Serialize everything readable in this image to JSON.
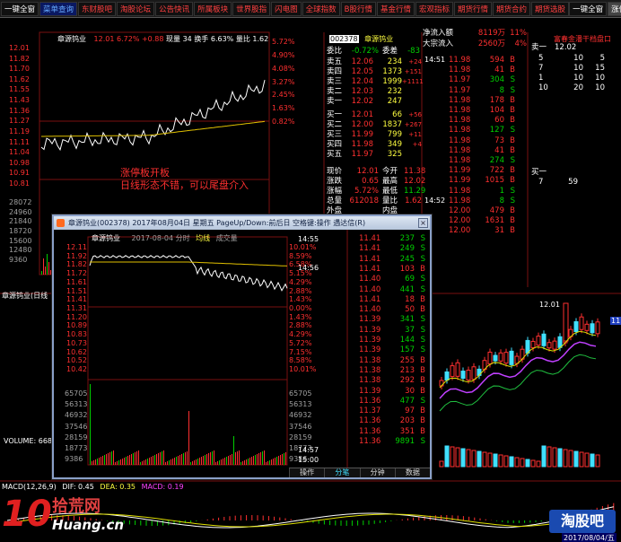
{
  "toolbar": {
    "items": [
      "一键全窗",
      "菜单查询",
      "东财股吧",
      "淘股论坛",
      "公告快讯",
      "所属板块",
      "世界股指",
      "闪电图",
      "全球指数",
      "B股行情",
      "基金行情",
      "宏观指标",
      "期货行情",
      "期货合约",
      "期货选股"
    ],
    "right_items": [
      "一键全窗",
      "涨停闪买"
    ]
  },
  "main_chart": {
    "title": "章源钨业",
    "price": "12.01",
    "pct": "6.72%",
    "change": "+0.88",
    "vol_label": "现量 34",
    "turnover": "换手 6.63%",
    "ratio": "量比 1.62",
    "price_labels": [
      "12.01",
      "11.82",
      "11.70",
      "11.62",
      "11.55",
      "11.43",
      "11.36",
      "11.27",
      "11.19",
      "11.11",
      "11.04",
      "10.98",
      "10.91",
      "10.81"
    ],
    "pct_labels": [
      "5.72%",
      "4.90%",
      "4.08%",
      "3.27%",
      "2.45%",
      "1.63%",
      "0.82%"
    ],
    "vol_labels": [
      "28072",
      "24960",
      "21840",
      "18720",
      "15600",
      "12480",
      "9360"
    ],
    "annotation_line1": "涨停板开板",
    "annotation_line2": "日线形态不错，可以尾盘介入",
    "daily_label": "章源钨业(日线"
  },
  "quote": {
    "code": "002378",
    "name": "章源钨业",
    "weibi_label": "委比",
    "weibi_value": "-0.72%",
    "weicha_label": "委差",
    "weicha_value": "-83",
    "sells": [
      {
        "label": "卖五",
        "price": "12.06",
        "vol": "234",
        "chg": "+24"
      },
      {
        "label": "卖四",
        "price": "12.05",
        "vol": "1373",
        "chg": "+151"
      },
      {
        "label": "卖三",
        "price": "12.04",
        "vol": "1999",
        "chg": "+1111"
      },
      {
        "label": "卖二",
        "price": "12.03",
        "vol": "232",
        "chg": ""
      },
      {
        "label": "卖一",
        "price": "12.02",
        "vol": "247",
        "chg": ""
      }
    ],
    "buys": [
      {
        "label": "买一",
        "price": "12.01",
        "vol": "66",
        "chg": "+56"
      },
      {
        "label": "买二",
        "price": "12.00",
        "vol": "1837",
        "chg": "+267"
      },
      {
        "label": "买三",
        "price": "11.99",
        "vol": "799",
        "chg": "+11"
      },
      {
        "label": "买四",
        "price": "11.98",
        "vol": "349",
        "chg": "+4"
      },
      {
        "label": "买五",
        "price": "11.97",
        "vol": "325",
        "chg": ""
      }
    ],
    "stats": [
      {
        "l1": "现价",
        "v1": "12.01",
        "l2": "今开",
        "v2": "11.38"
      },
      {
        "l1": "涨跌",
        "v1": "0.65",
        "l2": "最高",
        "v2": "12.02"
      },
      {
        "l1": "涨幅",
        "v1": "5.72%",
        "l2": "最低",
        "v2": "11.29"
      },
      {
        "l1": "总量",
        "v1": "612018",
        "l2": "量比",
        "v2": "1.62"
      },
      {
        "l1": "外盘",
        "v1": "",
        "l2": "内盘",
        "v2": ""
      }
    ]
  },
  "ticks": {
    "inflow_label": "净流入额",
    "inflow_value": "8119万",
    "inflow_pct": "11%",
    "big_label": "大宗流入",
    "big_value": "2560万",
    "big_pct": "4%",
    "time1": "14:51",
    "time2": "14:52",
    "rows": [
      {
        "p": "11.98",
        "v": "594",
        "f": "B"
      },
      {
        "p": "11.98",
        "v": "41",
        "f": "B"
      },
      {
        "p": "11.97",
        "v": "304",
        "f": "S"
      },
      {
        "p": "11.97",
        "v": "8",
        "f": "S"
      },
      {
        "p": "11.98",
        "v": "178",
        "f": "B"
      },
      {
        "p": "11.98",
        "v": "104",
        "f": "B"
      },
      {
        "p": "11.98",
        "v": "60",
        "f": "B"
      },
      {
        "p": "11.98",
        "v": "127",
        "f": "S"
      },
      {
        "p": "11.98",
        "v": "73",
        "f": "B"
      },
      {
        "p": "11.98",
        "v": "41",
        "f": "B"
      },
      {
        "p": "11.98",
        "v": "274",
        "f": "S"
      },
      {
        "p": "11.99",
        "v": "722",
        "f": "B"
      },
      {
        "p": "11.99",
        "v": "1015",
        "f": "B"
      },
      {
        "p": "11.98",
        "v": "1",
        "f": "S"
      },
      {
        "p": "11.98",
        "v": "8",
        "f": "S"
      },
      {
        "p": "12.00",
        "v": "479",
        "f": "B"
      },
      {
        "p": "12.00",
        "v": "1631",
        "f": "B"
      },
      {
        "p": "12.00",
        "v": "31",
        "f": "B"
      }
    ]
  },
  "far_right": {
    "header": "富春金潘干档盘口",
    "sell_label": "卖一",
    "sell_price": "12.02",
    "levels": [
      {
        "n": "5",
        "a": "10",
        "b": "5"
      },
      {
        "n": "7",
        "a": "10",
        "b": "15"
      },
      {
        "n": "1",
        "a": "10",
        "b": "10"
      },
      {
        "n": "10",
        "a": "20",
        "b": "10"
      }
    ],
    "buy_label": "买一",
    "buy_row": {
      "a": "7",
      "b": "59"
    }
  },
  "popup": {
    "title": "章源钨业(002378) 2017年08月04日 星期五 PageUp/Down:前后日 空格键:操作 遇达信(R)",
    "subtitle_name": "章源钨业",
    "subtitle_date": "2017-08-04 分时",
    "subtitle_tag1": "均线",
    "subtitle_tag2": "成交量",
    "close_glyph": "×",
    "price_labels": [
      "12.11",
      "11.92",
      "11.82",
      "11.72",
      "11.61",
      "11.51",
      "11.41",
      "11.31",
      "11.20",
      "10.89",
      "10.83",
      "10.73",
      "10.62",
      "10.52",
      "10.42"
    ],
    "pct_labels": [
      "10.01%",
      "8.59%",
      "6.58%",
      "5.15%",
      "4.29%",
      "2.88%",
      "1.43%",
      "0.00%",
      "1.43%",
      "2.88%",
      "4.29%",
      "5.72%",
      "7.15%",
      "8.58%",
      "10.01%"
    ],
    "vol_labels": [
      "65705",
      "56313",
      "46932",
      "37546",
      "28159",
      "18773",
      "9386"
    ],
    "vol_labels_r": [
      "65705",
      "56313",
      "46932",
      "37546",
      "28159",
      "18773",
      "9386"
    ],
    "time_a": "14:55",
    "time_b": "14:56",
    "time_c": "14:57",
    "time_d": "15:00",
    "ticks": [
      {
        "p": "11.41",
        "v": "237",
        "f": "S"
      },
      {
        "p": "11.41",
        "v": "249",
        "f": "S"
      },
      {
        "p": "11.41",
        "v": "245",
        "f": "S"
      },
      {
        "p": "11.41",
        "v": "103",
        "f": "B"
      },
      {
        "p": "11.40",
        "v": "69",
        "f": "S"
      },
      {
        "p": "11.40",
        "v": "441",
        "f": "S"
      },
      {
        "p": "11.41",
        "v": "18",
        "f": "B"
      },
      {
        "p": "11.40",
        "v": "50",
        "f": "B"
      },
      {
        "p": "11.39",
        "v": "341",
        "f": "S"
      },
      {
        "p": "11.39",
        "v": "37",
        "f": "S"
      },
      {
        "p": "11.39",
        "v": "144",
        "f": "S"
      },
      {
        "p": "11.39",
        "v": "157",
        "f": "S"
      },
      {
        "p": "11.38",
        "v": "255",
        "f": "B"
      },
      {
        "p": "11.38",
        "v": "213",
        "f": "B"
      },
      {
        "p": "11.38",
        "v": "292",
        "f": "B"
      },
      {
        "p": "11.39",
        "v": "30",
        "f": "B"
      },
      {
        "p": "11.36",
        "v": "477",
        "f": "S"
      },
      {
        "p": "11.37",
        "v": "97",
        "f": "B"
      },
      {
        "p": "11.36",
        "v": "203",
        "f": "B"
      },
      {
        "p": "11.36",
        "v": "351",
        "f": "B"
      },
      {
        "p": "11.36",
        "v": "9891",
        "f": "S"
      }
    ],
    "tabs": [
      "操作",
      "分笔",
      "分钟",
      "数据"
    ]
  },
  "bottom": {
    "volume_label": "VOLUME: 668",
    "macd_label": "MACD(12,26,9)",
    "dif": "DIF: 0.45",
    "dea": "DEA: 0.35",
    "macd": "MACD: 0.19",
    "candle_price": "12.01",
    "right_price": "11.",
    "date_label": "2017/08/04/五"
  },
  "watermark": {
    "left_big": "10",
    "left_text": "拾荒网",
    "left_url": "Huang.cn",
    "right_text": "淘股吧"
  },
  "colors": {
    "up": "#ff3030",
    "down": "#00d000",
    "title": "#ffff40",
    "accent": "#40e0ff"
  }
}
